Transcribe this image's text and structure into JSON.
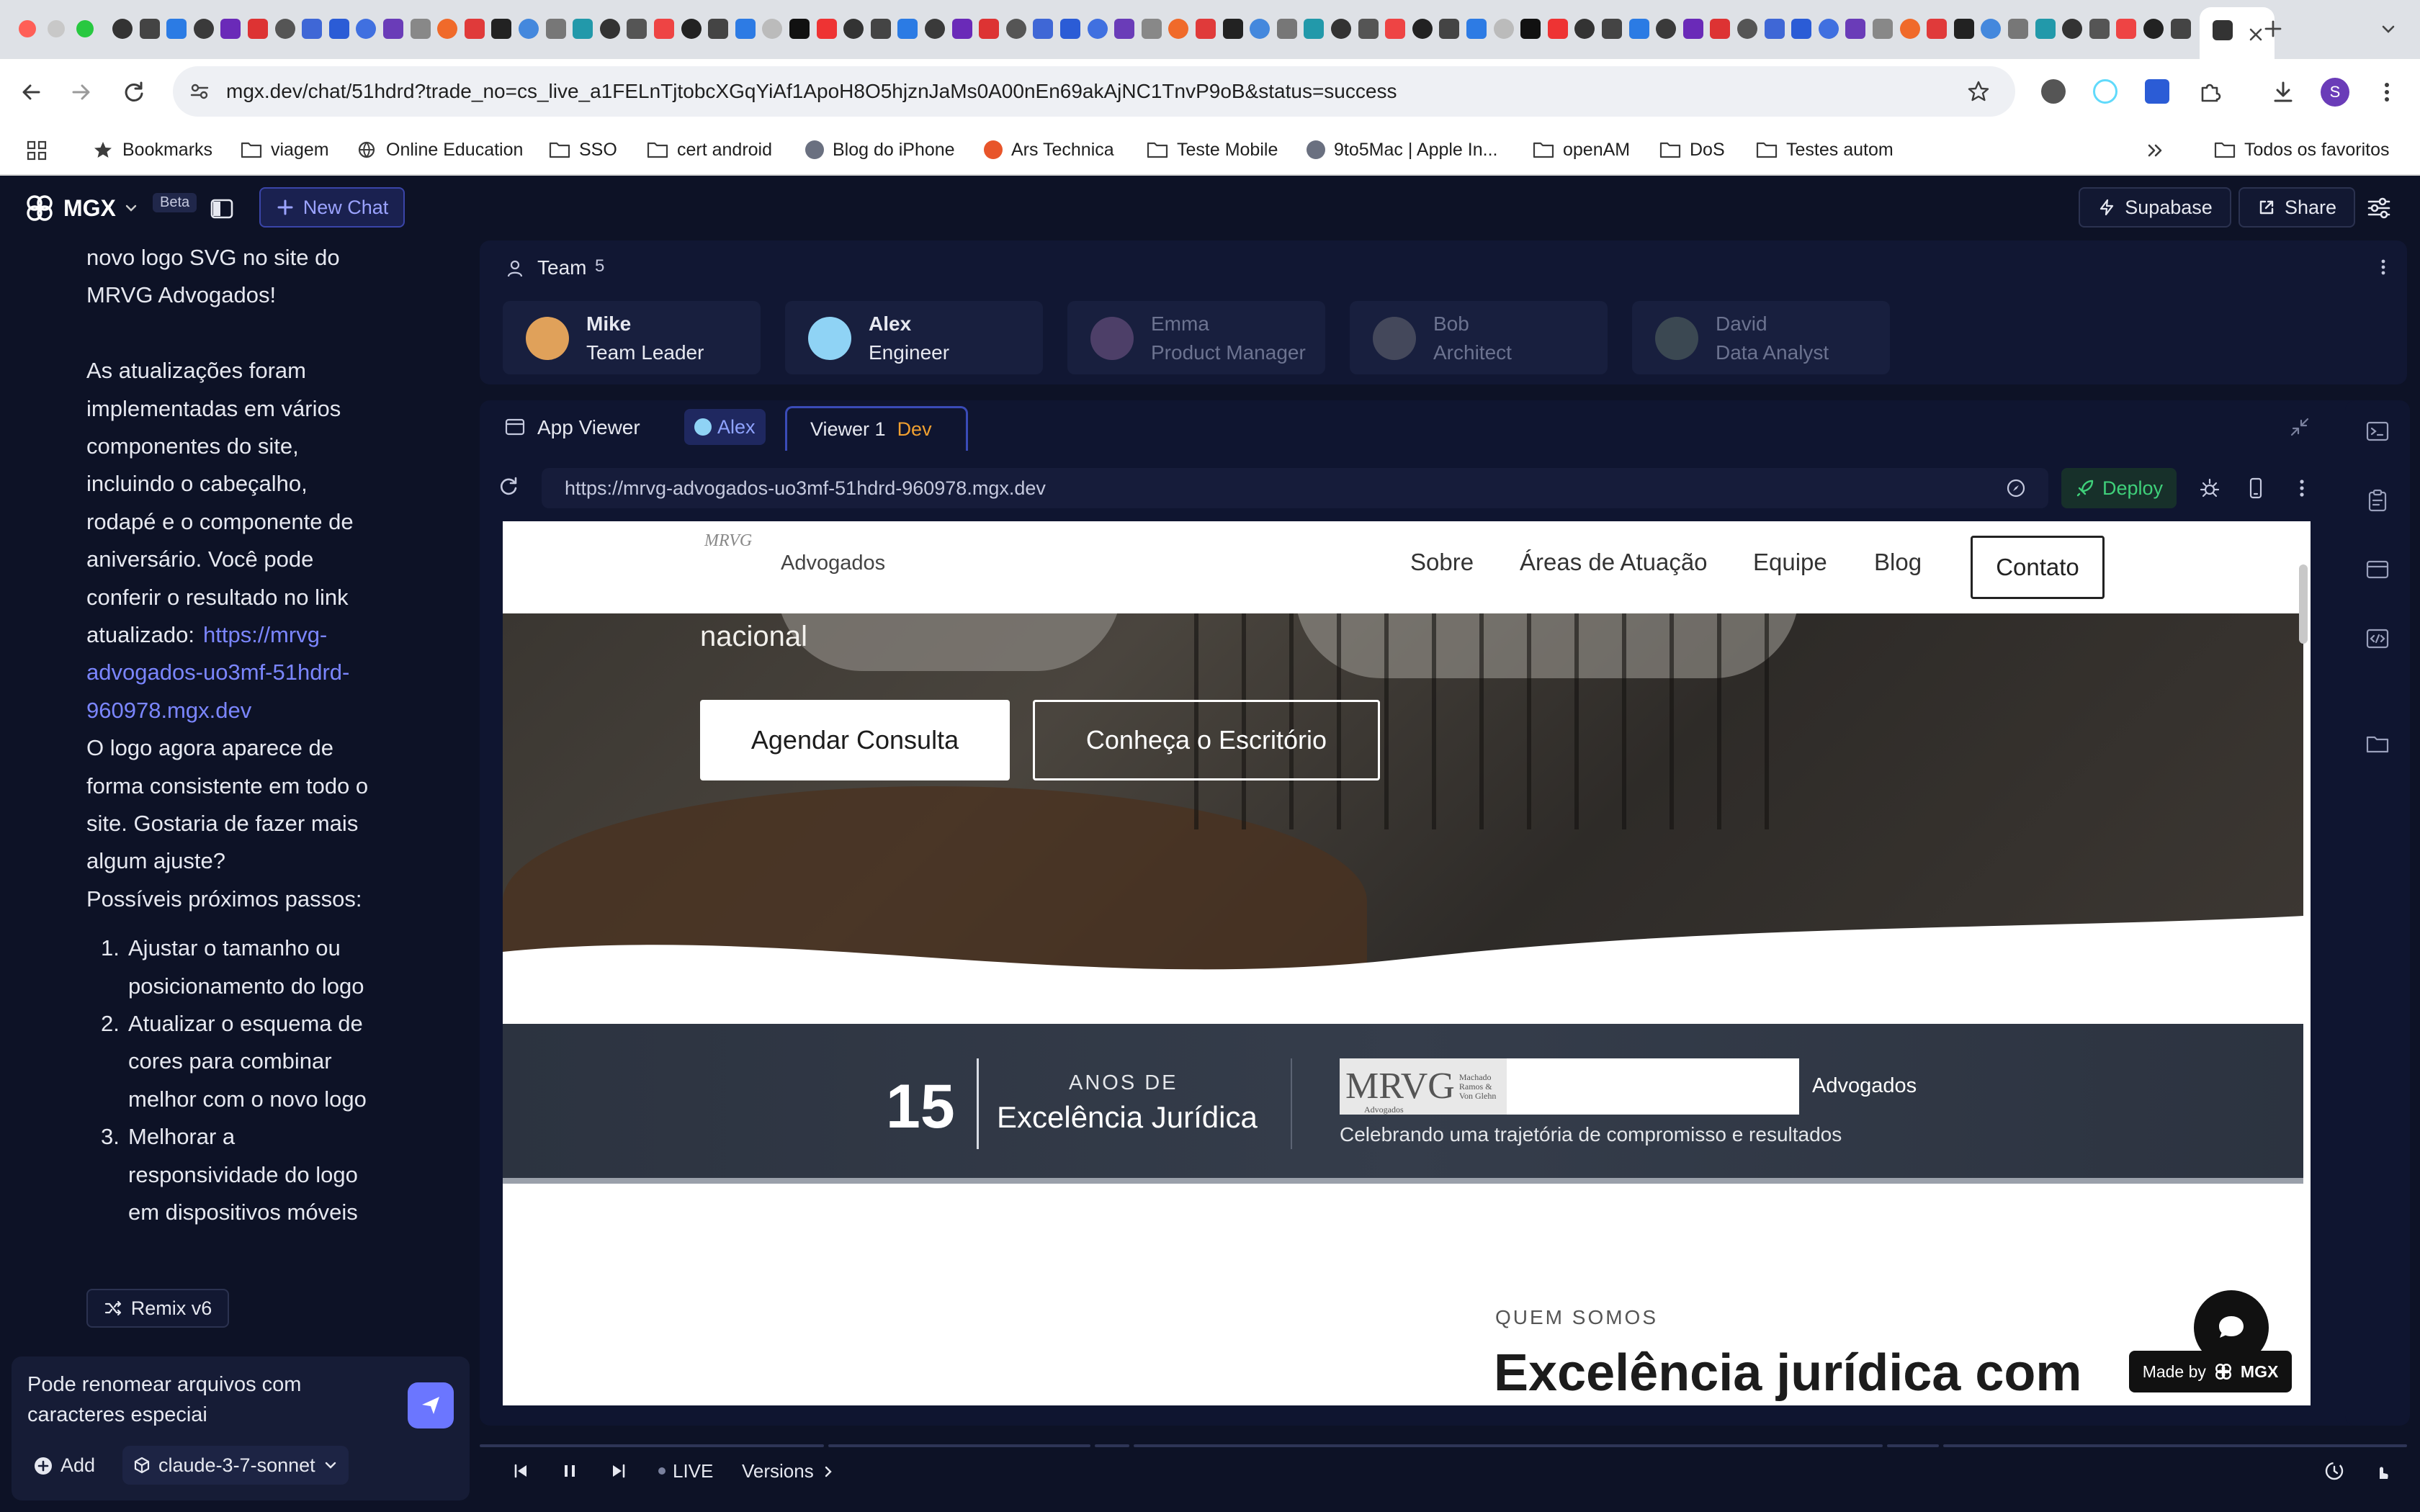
{
  "browser": {
    "url": "mgx.dev/chat/51hdrd?trade_no=cs_live_a1FELnTjtobcXGqYiAf1ApoH8O5hjznJaMs0A00nEn69akAjNC1TnvP9oB&status=success",
    "profile_initial": "S",
    "bookmarks": [
      {
        "label": "Bookmarks",
        "icon": "star-icon"
      },
      {
        "label": "viagem",
        "icon": "folder-icon"
      },
      {
        "label": "Online Education",
        "icon": "globe-icon"
      },
      {
        "label": "SSO",
        "icon": "folder-icon"
      },
      {
        "label": "cert android",
        "icon": "folder-icon"
      },
      {
        "label": "Blog do iPhone",
        "icon": "site-icon"
      },
      {
        "label": "Ars Technica",
        "icon": "site-icon"
      },
      {
        "label": "Teste Mobile",
        "icon": "folder-icon"
      },
      {
        "label": "9to5Mac | Apple In...",
        "icon": "site-icon"
      },
      {
        "label": "openAM",
        "icon": "folder-icon"
      },
      {
        "label": "DoS",
        "icon": "folder-icon"
      },
      {
        "label": "Testes autom",
        "icon": "folder-icon"
      }
    ],
    "all_bookmarks": "Todos os favoritos"
  },
  "app": {
    "logo": "MGX",
    "beta": "Beta",
    "new_chat": "New Chat",
    "supabase": "Supabase",
    "share": "Share"
  },
  "chat": {
    "lines": [
      "novo logo SVG no site do",
      "MRVG Advogados!",
      "",
      "As atualizações foram",
      "implementadas em vários",
      "componentes do site,",
      "incluindo o cabeçalho,",
      "rodapé e o componente de",
      "aniversário. Você pode",
      "conferir o resultado no link",
      "atualizado:"
    ],
    "link_lines": [
      "https://mrvg-",
      "advogados-uo3mf-51hdrd-",
      "960978.mgx.dev"
    ],
    "after_lines": [
      "O logo agora aparece de",
      "forma consistente em todo o",
      "site. Gostaria de fazer mais",
      "algum ajuste?",
      "Possíveis próximos passos:"
    ],
    "steps": [
      [
        "1.",
        "Ajustar o tamanho ou",
        "posicionamento do logo"
      ],
      [
        "2.",
        "Atualizar o esquema de",
        "cores para combinar",
        "melhor com o novo logo"
      ],
      [
        "3.",
        "Melhorar a",
        "responsividade do logo",
        "em dispositivos móveis"
      ]
    ],
    "remix": "Remix v6",
    "input_line1": "Pode renomear arquivos com",
    "input_line2": "caracteres especiai",
    "add": "Add",
    "model": "claude-3-7-sonnet"
  },
  "team": {
    "title": "Team",
    "count": "5",
    "members": [
      {
        "name": "Mike",
        "role": "Team Leader",
        "active": true,
        "color": "#e0a15a"
      },
      {
        "name": "Alex",
        "role": "Engineer",
        "active": true,
        "color": "#8fd3f5"
      },
      {
        "name": "Emma",
        "role": "Product Manager",
        "active": false,
        "color": "#7a5a8a"
      },
      {
        "name": "Bob",
        "role": "Architect",
        "active": false,
        "color": "#6a6a72"
      },
      {
        "name": "David",
        "role": "Data Analyst",
        "active": false,
        "color": "#5a6a62"
      }
    ]
  },
  "viewer": {
    "app_viewer": "App Viewer",
    "alex_tab": "Alex",
    "viewer_tab": "Viewer 1",
    "dev_badge": "Dev",
    "address": "https://mrvg-advogados-uo3mf-51hdrd-960978.mgx.dev",
    "deploy": "Deploy"
  },
  "site": {
    "logo_text": "MRVG",
    "brand_suffix": "Advogados",
    "nav": [
      "Sobre",
      "Áreas de Atuação",
      "Equipe",
      "Blog"
    ],
    "contact": "Contato",
    "hero_text": "nacional",
    "cta_primary": "Agendar Consulta",
    "cta_secondary": "Conheça o Escritório",
    "years": "15",
    "anos_de": "ANOS DE",
    "excellence": "Excelência Jurídica",
    "logo_big": "MRVG",
    "logo_small_1": "Machado",
    "logo_small_2": "Ramos &",
    "logo_small_3": "Von Glehn",
    "logo_sub": "Advogados",
    "banner_brand": "Advogados",
    "banner_tagline": "Celebrando uma trajetória de compromisso e resultados",
    "section_label": "QUEM SOMOS",
    "section_heading": "Excelência jurídica com",
    "made_by": "Made by",
    "made_by_brand": "MGX"
  },
  "player": {
    "live": "LIVE",
    "versions": "Versions"
  },
  "colors": {
    "accent": "#6b76ff",
    "deploy_green": "#3fd07a",
    "dev_orange": "#f0a030",
    "link": "#7b86ff"
  }
}
